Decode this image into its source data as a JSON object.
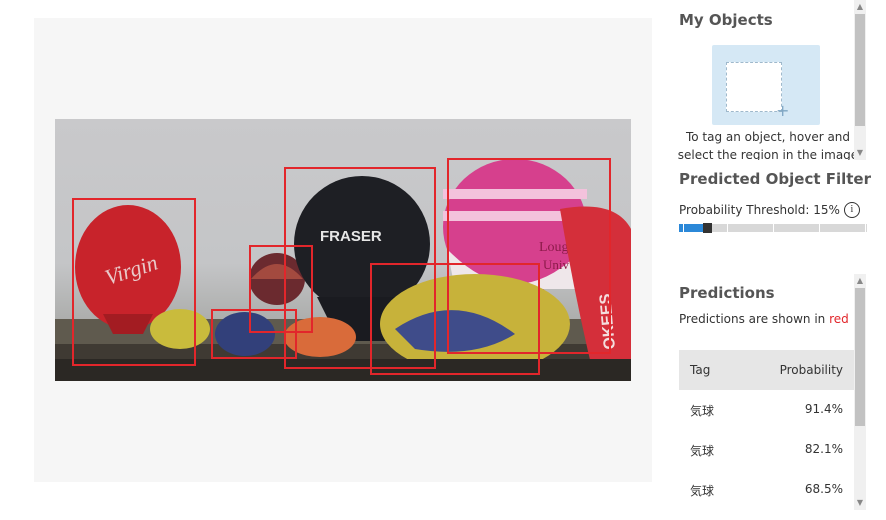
{
  "my_objects": {
    "title": "My Objects",
    "hint_line1": "To tag an object, hover and",
    "hint_line2": "select the region in the image",
    "plus_glyph": "+"
  },
  "filter": {
    "title": "Predicted Object Filter",
    "threshold_label": "Probability Threshold: 15%",
    "info_glyph": "i",
    "threshold_fraction": 0.15
  },
  "predictions": {
    "title": "Predictions",
    "legend_prefix": "Predictions are shown in",
    "legend_color_word": "red",
    "columns": {
      "tag": "Tag",
      "probability": "Probability"
    },
    "rows": [
      {
        "tag": "気球",
        "probability": "91.4%"
      },
      {
        "tag": "気球",
        "probability": "82.1%"
      },
      {
        "tag": "気球",
        "probability": "68.5%"
      }
    ]
  },
  "photo_text": {
    "virgin": "Virgin",
    "fraser": "FRASER",
    "univ": "Univ",
    "loug": "Loug",
    "right_banner": "OKEES"
  },
  "colors": {
    "bbox": "#e2262b",
    "accent": "#2b88d8"
  },
  "scroll_glyphs": {
    "up": "▲",
    "down": "▼"
  }
}
